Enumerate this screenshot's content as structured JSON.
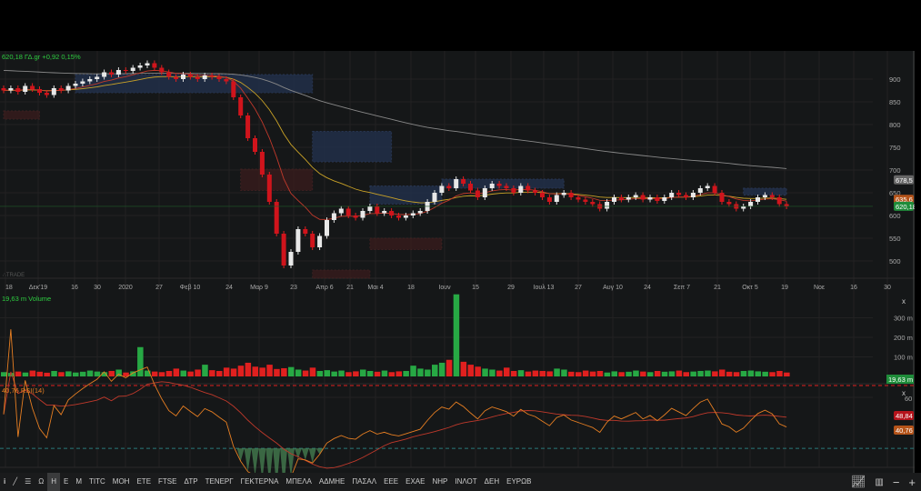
{
  "header": {
    "quote": "620,18 ΓΔ.gr +0,92 0,15%",
    "quote_color": "#2ecc40"
  },
  "watermark": "∴TRADE",
  "volume_panel": {
    "label": "19,63 m Volume",
    "ticks": [
      "300 m",
      "200 m",
      "100 m"
    ],
    "badge": "19,63 m",
    "close": "x"
  },
  "rsi_panel": {
    "label": "40,76 RSI(14)",
    "ticks": [
      "60"
    ],
    "badge_ma": "48,84",
    "badge_rsi": "40,76",
    "close": "x"
  },
  "price_badges": {
    "ma_long": "678,5",
    "ma_mid": "635,6",
    "last": "620,18"
  },
  "toolbar": {
    "items": [
      "Ω",
      "Η",
      "Ε",
      "Μ",
      "ΤΙΤC",
      "ΜΟΗ",
      "ΕΤΕ",
      "FTSE",
      "ΔΤΡ",
      "ΤΕΝΕΡΓ",
      "ΓΕΚΤΕΡΝΑ",
      "ΜΠΕΛΑ",
      "ΑΔΜΗΕ",
      "ΠΑΣΑΛ",
      "ΕΕΕ",
      "ΕΧΑΕ",
      "ΝΗΡ",
      "ΙΝΛΟΤ",
      "ΔΕΗ",
      "ΕΥΡΩΒ"
    ],
    "active": "Η"
  },
  "chart_data": {
    "type": "candlestick",
    "y_ticks": [
      900,
      850,
      800,
      750,
      700,
      650,
      600,
      550,
      500
    ],
    "ylim": [
      455,
      960
    ],
    "x_labels": [
      "18",
      "Δεκ'19",
      "16",
      "30",
      "2020",
      "27",
      "Φεβ 10",
      "24",
      "Μαρ 9",
      "23",
      "Απρ 6",
      "21",
      "Μαι 4",
      "18",
      "Ιουν",
      "15",
      "29",
      "Ιουλ 13",
      "27",
      "Αυγ 10",
      "24",
      "Σεπ 7",
      "21",
      "Οκτ 5",
      "19",
      "Νοε",
      "16",
      "30"
    ],
    "closes": [
      875,
      880,
      872,
      885,
      878,
      870,
      865,
      880,
      875,
      885,
      890,
      895,
      900,
      905,
      915,
      910,
      920,
      918,
      925,
      930,
      935,
      925,
      915,
      905,
      900,
      910,
      905,
      900,
      908,
      905,
      900,
      895,
      860,
      820,
      770,
      740,
      690,
      630,
      560,
      490,
      520,
      570,
      560,
      530,
      555,
      590,
      605,
      615,
      600,
      595,
      610,
      620,
      605,
      610,
      600,
      595,
      600,
      605,
      610,
      630,
      650,
      665,
      660,
      680,
      670,
      655,
      640,
      660,
      670,
      665,
      660,
      650,
      665,
      655,
      650,
      640,
      630,
      645,
      650,
      640,
      635,
      630,
      625,
      615,
      630,
      640,
      635,
      640,
      645,
      635,
      640,
      632,
      640,
      650,
      645,
      640,
      650,
      660,
      665,
      650,
      630,
      625,
      615,
      620,
      630,
      640,
      645,
      640,
      625,
      620
    ],
    "volumes_m": [
      22,
      18,
      25,
      20,
      30,
      24,
      19,
      28,
      22,
      26,
      20,
      24,
      30,
      25,
      22,
      28,
      35,
      20,
      26,
      150,
      30,
      25,
      22,
      28,
      40,
      30,
      25,
      35,
      60,
      32,
      28,
      45,
      40,
      55,
      70,
      50,
      45,
      60,
      38,
      42,
      48,
      35,
      30,
      45,
      28,
      32,
      25,
      30,
      22,
      26,
      35,
      28,
      24,
      30,
      22,
      26,
      28,
      55,
      40,
      35,
      60,
      70,
      85,
      420,
      75,
      60,
      50,
      40,
      35,
      30,
      45,
      28,
      32,
      25,
      30,
      28,
      26,
      40,
      35,
      24,
      22,
      30,
      25,
      28,
      20,
      26,
      22,
      24,
      30,
      25,
      22,
      28,
      24,
      26,
      30,
      22,
      25,
      28,
      30,
      26,
      35,
      24,
      22,
      28,
      30,
      26,
      24,
      22,
      28,
      20
    ],
    "zones": [
      {
        "from": 10,
        "to": 43,
        "top": 910,
        "bottom": 870,
        "kind": "supply"
      },
      {
        "from": 43,
        "to": 54,
        "top": 785,
        "bottom": 718,
        "kind": "supply"
      },
      {
        "from": 33,
        "to": 43,
        "top": 702,
        "bottom": 655,
        "kind": "demand"
      },
      {
        "from": 51,
        "to": 61,
        "top": 665,
        "bottom": 625,
        "kind": "supply"
      },
      {
        "from": 61,
        "to": 78,
        "top": 680,
        "bottom": 660,
        "kind": "supply"
      },
      {
        "from": 51,
        "to": 61,
        "top": 550,
        "bottom": 525,
        "kind": "demand"
      },
      {
        "from": 43,
        "to": 51,
        "top": 480,
        "bottom": 462,
        "kind": "demand"
      },
      {
        "from": 103,
        "to": 109,
        "top": 660,
        "bottom": 645,
        "kind": "supply"
      },
      {
        "from": 0,
        "to": 5,
        "top": 830,
        "bottom": 812,
        "kind": "demand"
      }
    ]
  }
}
